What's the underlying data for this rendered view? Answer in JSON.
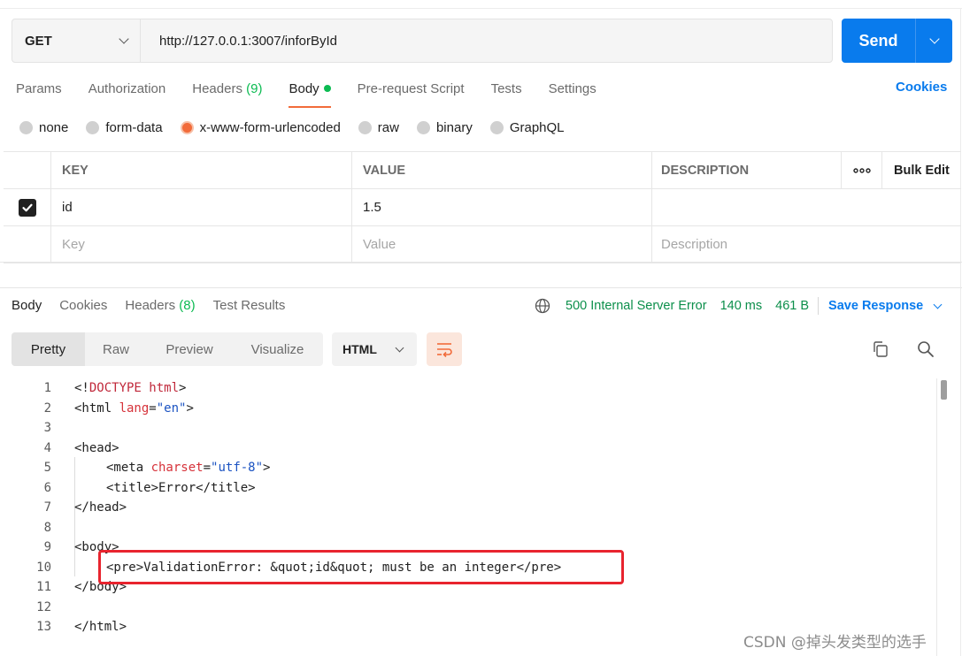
{
  "request": {
    "method": "GET",
    "url": "http://127.0.0.1:3007/inforById",
    "send_label": "Send"
  },
  "req_tabs": {
    "params": "Params",
    "authorization": "Authorization",
    "headers": "Headers",
    "headers_count": "(9)",
    "body": "Body",
    "prerequest": "Pre-request Script",
    "tests": "Tests",
    "settings": "Settings",
    "cookies": "Cookies"
  },
  "body_types": {
    "none": "none",
    "form_data": "form-data",
    "urlencoded": "x-www-form-urlencoded",
    "raw": "raw",
    "binary": "binary",
    "graphql": "GraphQL",
    "selected": "x-www-form-urlencoded"
  },
  "kv_table": {
    "headers": {
      "key": "KEY",
      "value": "VALUE",
      "description": "DESCRIPTION",
      "more": "ooo",
      "bulk_edit": "Bulk Edit"
    },
    "row1": {
      "key": "id",
      "value": "1.5",
      "checked": true
    },
    "placeholders": {
      "key": "Key",
      "value": "Value",
      "description": "Description"
    }
  },
  "response": {
    "tabs": {
      "body": "Body",
      "cookies": "Cookies",
      "headers": "Headers",
      "headers_count": "(8)",
      "test_results": "Test Results"
    },
    "status": "500 Internal Server Error",
    "time": "140 ms",
    "size": "461 B",
    "save_response": "Save Response",
    "formats": {
      "pretty": "Pretty",
      "raw": "Raw",
      "preview": "Preview",
      "visualize": "Visualize"
    },
    "language": "HTML"
  },
  "code_lines": {
    "n1": "1",
    "n2": "2",
    "n3": "3",
    "n4": "4",
    "n5": "5",
    "n6": "6",
    "n7": "7",
    "n8": "8",
    "n9": "9",
    "n10": "10",
    "n11": "11",
    "n12": "12",
    "n13": "13",
    "l1_a": "<!",
    "l1_b": "DOCTYPE",
    "l1_c": " html",
    "l1_d": ">",
    "l2_a": "<html ",
    "l2_b": "lang",
    "l2_c": "=",
    "l2_d": "\"en\"",
    "l2_e": ">",
    "l4": "<head>",
    "l5_a": "<meta ",
    "l5_b": "charset",
    "l5_c": "=",
    "l5_d": "\"utf-8\"",
    "l5_e": ">",
    "l6": "<title>Error</title>",
    "l7": "</head>",
    "l9": "<body>",
    "l10": "<pre>ValidationError: &quot;id&quot; must be an integer</pre>",
    "l11": "</body>",
    "l13": "</html>"
  },
  "watermark": "CSDN @掉头发类型的选手",
  "colors": {
    "accent": "#097bed",
    "active_tab": "#f26b3a",
    "status_green": "#0c8f4b",
    "highlight": "#e8242e"
  }
}
